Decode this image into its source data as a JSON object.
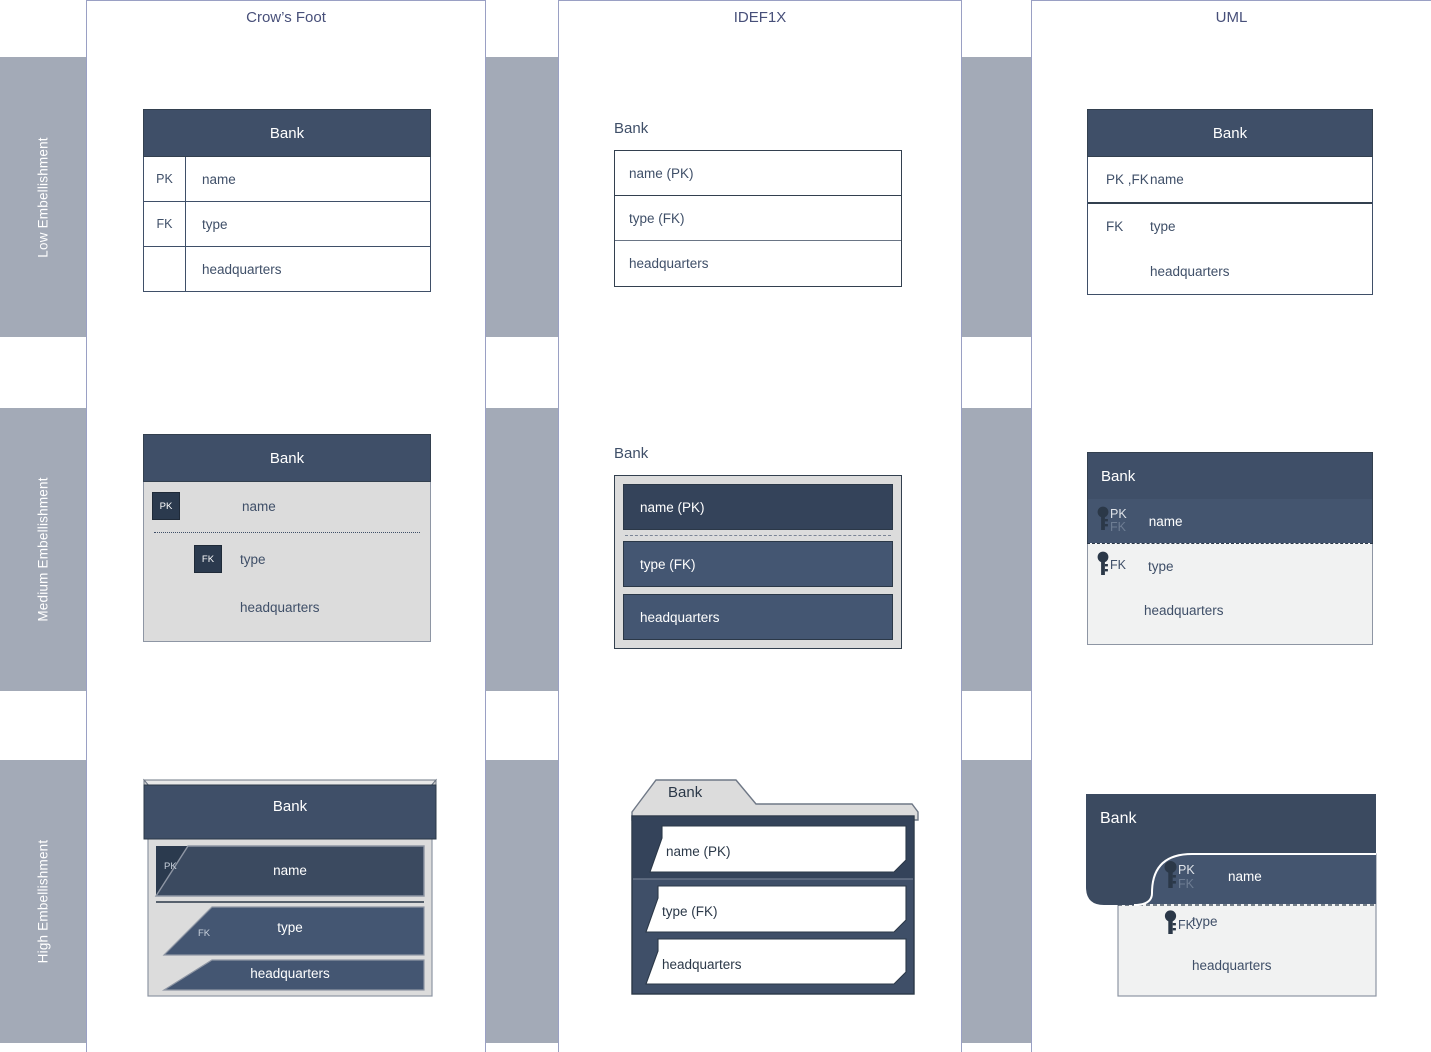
{
  "rows": [
    {
      "id": "low",
      "label": "Low Embellishment"
    },
    {
      "id": "medium",
      "label": "Medium Embellishment"
    },
    {
      "id": "high",
      "label": "High Embellishment"
    }
  ],
  "columns": [
    {
      "id": "crowsfoot",
      "title": "Crow’s Foot"
    },
    {
      "id": "idef1x",
      "title": "IDEF1X"
    },
    {
      "id": "uml",
      "title": "UML"
    }
  ],
  "entity": {
    "name": "Bank",
    "attributes": [
      {
        "name": "name",
        "key": "PK",
        "idef_label": "name (PK)",
        "key_suffix": "(PK)"
      },
      {
        "name": "type",
        "key": "FK",
        "idef_label": "type (FK)",
        "key_suffix": "(FK)"
      },
      {
        "name": "headquarters",
        "key": "",
        "idef_label": "headquarters",
        "key_suffix": ""
      }
    ]
  },
  "crowsfoot": {
    "low": {
      "title": "Bank",
      "rows": [
        {
          "key": "PK",
          "attr": "name"
        },
        {
          "key": "FK",
          "attr": "type"
        },
        {
          "key": "",
          "attr": "headquarters"
        }
      ]
    },
    "medium": {
      "title": "Bank",
      "rows": [
        {
          "badge": "PK",
          "attr": "name"
        },
        {
          "badge": "FK",
          "attr": "type"
        },
        {
          "badge": "",
          "attr": "headquarters"
        }
      ]
    },
    "high": {
      "title": "Bank",
      "rows": [
        {
          "badge": "PK",
          "attr": "name"
        },
        {
          "badge": "FK",
          "attr": "type"
        },
        {
          "badge": "",
          "attr": "headquarters"
        }
      ]
    }
  },
  "idef1x": {
    "low": {
      "title": "Bank",
      "rows": [
        "name (PK)",
        "type (FK)",
        "headquarters"
      ]
    },
    "medium": {
      "title": "Bank",
      "rows": [
        "name (PK)",
        "type (FK)",
        "headquarters"
      ]
    },
    "high": {
      "title": "Bank",
      "rows": [
        "name (PK)",
        "type (FK)",
        "headquarters"
      ]
    }
  },
  "uml": {
    "low": {
      "title": "Bank",
      "rows": [
        {
          "key": "PK ,FK",
          "attr": "name"
        },
        {
          "key": "FK",
          "attr": "type"
        },
        {
          "key": "",
          "attr": "headquarters"
        }
      ]
    },
    "medium": {
      "title": "Bank",
      "rows": [
        {
          "key_top": "PK",
          "key_bottom": "FK",
          "attr": "name"
        },
        {
          "key_top": "FK",
          "key_bottom": "",
          "attr": "type"
        },
        {
          "key_top": "",
          "key_bottom": "",
          "attr": "headquarters"
        }
      ]
    },
    "high": {
      "title": "Bank",
      "rows": [
        {
          "key_top": "PK",
          "key_bottom": "FK",
          "attr": "name"
        },
        {
          "key_top": "FK",
          "key_bottom": "",
          "attr": "type"
        },
        {
          "key_top": "",
          "key_bottom": "",
          "attr": "headquarters"
        }
      ]
    }
  },
  "icons": {
    "key": "key-icon"
  },
  "colors": {
    "navy": "#3f4f68",
    "navy_dark": "#33404f",
    "navy_mid": "#44556f",
    "band_gray": "#a3aab7",
    "panel_border": "#9aa0c4",
    "light_gray": "#dcdcdc",
    "near_white": "#f1f2f2",
    "white": "#ffffff"
  }
}
